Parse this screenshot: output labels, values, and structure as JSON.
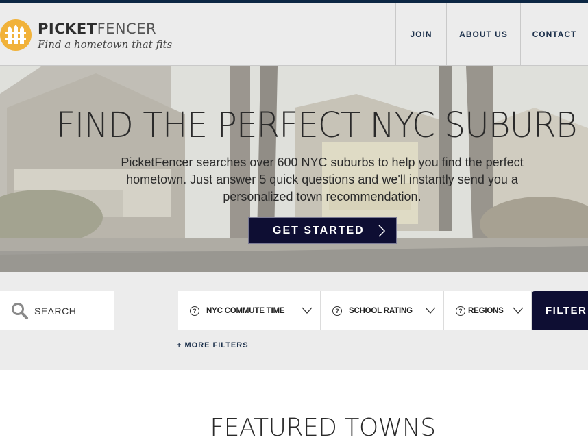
{
  "brand": {
    "name_bold": "PICKET",
    "name_light": "FENCER",
    "tagline": "Find a hometown that fits",
    "logo_color": "#f1b23a"
  },
  "nav": {
    "join": "JOIN",
    "about": "ABOUT US",
    "contact": "CONTACT"
  },
  "hero": {
    "title": "FIND THE PERFECT NYC SUBURB",
    "text": "PicketFencer searches over 600 NYC suburbs to help you find the perfect hometown. Just answer 5 quick questions and we'll instantly send you a personalized town recommendation.",
    "cta": "GET STARTED"
  },
  "filters": {
    "search_placeholder": "SEARCH",
    "commute": "NYC COMMUTE TIME",
    "school": "SCHOOL RATING",
    "regions": "REGIONS",
    "filter_button": "FILTER",
    "more_filters": "+ MORE FILTERS"
  },
  "featured": {
    "title": "FEATURED TOWNS"
  },
  "colors": {
    "navy": "#0e0e33",
    "header_bg": "#ececec",
    "top_line": "#0c2744"
  },
  "icons": [
    "picket-fence-logo-icon",
    "search-icon",
    "help-circle-icon",
    "chevron-down-icon",
    "chevron-right-icon"
  ]
}
